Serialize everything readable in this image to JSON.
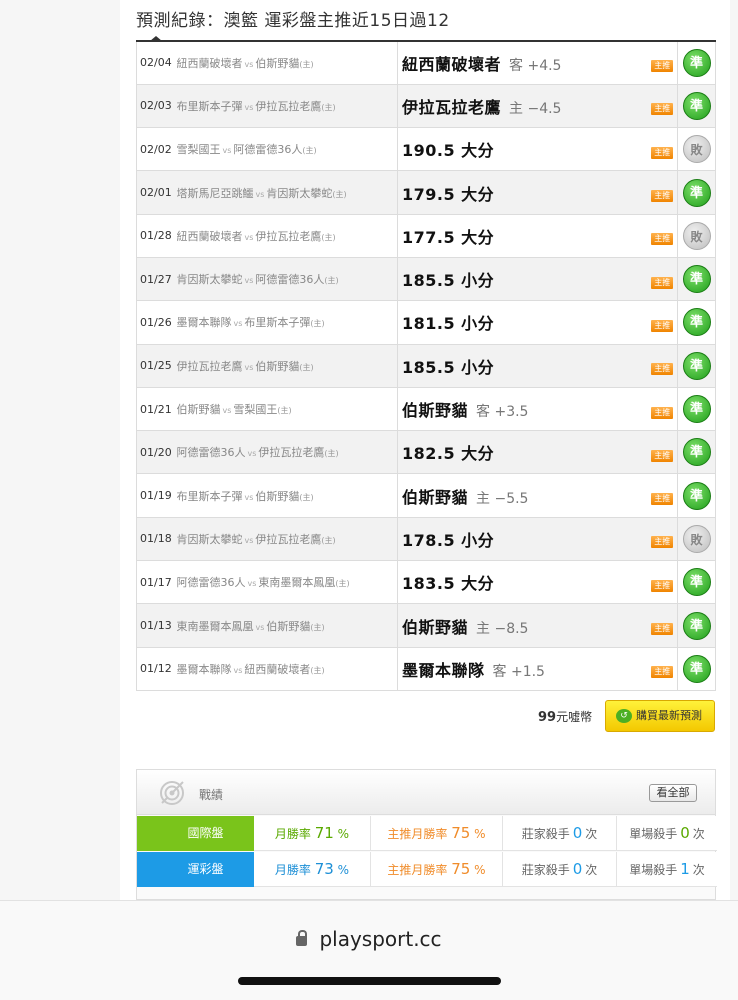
{
  "page": {
    "title": "預測紀錄：澳籃 運彩盤主推近15日過12"
  },
  "records": [
    {
      "date": "02/04",
      "away": "紐西蘭破壞者",
      "vs": "vs",
      "home": "伯斯野貓",
      "home_mark": "(主)",
      "pick": "紐西蘭破壞者",
      "line": "客 +4.5",
      "tag": "主推",
      "result": "準",
      "status": "win"
    },
    {
      "date": "02/03",
      "away": "布里斯本子彈",
      "vs": "vs",
      "home": "伊拉瓦拉老鷹",
      "home_mark": "(主)",
      "pick": "伊拉瓦拉老鷹",
      "line": "主 −4.5",
      "tag": "主推",
      "result": "準",
      "status": "win"
    },
    {
      "date": "02/02",
      "away": "雪梨國王",
      "vs": "vs",
      "home": "阿德雷德36人",
      "home_mark": "(主)",
      "pick": "190.5 大分",
      "line": "",
      "tag": "主推",
      "result": "敗",
      "status": "push"
    },
    {
      "date": "02/01",
      "away": "塔斯馬尼亞跳鱷",
      "vs": "vs",
      "home": "肯因斯太攀蛇",
      "home_mark": "(主)",
      "pick": "179.5 大分",
      "line": "",
      "tag": "主推",
      "result": "準",
      "status": "win"
    },
    {
      "date": "01/28",
      "away": "紐西蘭破壞者",
      "vs": "vs",
      "home": "伊拉瓦拉老鷹",
      "home_mark": "(主)",
      "pick": "177.5 大分",
      "line": "",
      "tag": "主推",
      "result": "敗",
      "status": "push"
    },
    {
      "date": "01/27",
      "away": "肯因斯太攀蛇",
      "vs": "vs",
      "home": "阿德雷德36人",
      "home_mark": "(主)",
      "pick": "185.5 小分",
      "line": "",
      "tag": "主推",
      "result": "準",
      "status": "win"
    },
    {
      "date": "01/26",
      "away": "墨爾本聯隊",
      "vs": "vs",
      "home": "布里斯本子彈",
      "home_mark": "(主)",
      "pick": "181.5 小分",
      "line": "",
      "tag": "主推",
      "result": "準",
      "status": "win"
    },
    {
      "date": "01/25",
      "away": "伊拉瓦拉老鷹",
      "vs": "vs",
      "home": "伯斯野貓",
      "home_mark": "(主)",
      "pick": "185.5 小分",
      "line": "",
      "tag": "主推",
      "result": "準",
      "status": "win"
    },
    {
      "date": "01/21",
      "away": "伯斯野貓",
      "vs": "vs",
      "home": "雪梨國王",
      "home_mark": "(主)",
      "pick": "伯斯野貓",
      "line": "客 +3.5",
      "tag": "主推",
      "result": "準",
      "status": "win"
    },
    {
      "date": "01/20",
      "away": "阿德雷德36人",
      "vs": "vs",
      "home": "伊拉瓦拉老鷹",
      "home_mark": "(主)",
      "pick": "182.5 大分",
      "line": "",
      "tag": "主推",
      "result": "準",
      "status": "win"
    },
    {
      "date": "01/19",
      "away": "布里斯本子彈",
      "vs": "vs",
      "home": "伯斯野貓",
      "home_mark": "(主)",
      "pick": "伯斯野貓",
      "line": "主 −5.5",
      "tag": "主推",
      "result": "準",
      "status": "win"
    },
    {
      "date": "01/18",
      "away": "肯因斯太攀蛇",
      "vs": "vs",
      "home": "伊拉瓦拉老鷹",
      "home_mark": "(主)",
      "pick": "178.5 小分",
      "line": "",
      "tag": "主推",
      "result": "敗",
      "status": "push"
    },
    {
      "date": "01/17",
      "away": "阿德雷德36人",
      "vs": "vs",
      "home": "東南墨爾本鳳凰",
      "home_mark": "(主)",
      "pick": "183.5 大分",
      "line": "",
      "tag": "主推",
      "result": "準",
      "status": "win"
    },
    {
      "date": "01/13",
      "away": "東南墨爾本鳳凰",
      "vs": "vs",
      "home": "伯斯野貓",
      "home_mark": "(主)",
      "pick": "伯斯野貓",
      "line": "主 −8.5",
      "tag": "主推",
      "result": "準",
      "status": "win"
    },
    {
      "date": "01/12",
      "away": "墨爾本聯隊",
      "vs": "vs",
      "home": "紐西蘭破壞者",
      "home_mark": "(主)",
      "pick": "墨爾本聯隊",
      "line": "客 +1.5",
      "tag": "主推",
      "result": "準",
      "status": "win"
    }
  ],
  "purchase": {
    "price": "99",
    "unit": "元噓幣",
    "button_label": "購買最新預測",
    "cart_glyph": "↺"
  },
  "stats": {
    "title": "戰績",
    "see_all": "看全部",
    "rows": [
      {
        "label": "國際盤",
        "monthly_label": "月勝率",
        "monthly": "71",
        "main_label": "主推月勝率",
        "main": "75",
        "pct": "%",
        "banker_label": "莊家殺手",
        "banker": "0",
        "single_label": "單場殺手",
        "single": "0",
        "times": "次",
        "color": "#7ac41b"
      },
      {
        "label": "運彩盤",
        "monthly_label": "月勝率",
        "monthly": "73",
        "main_label": "主推月勝率",
        "main": "75",
        "pct": "%",
        "banker_label": "莊家殺手",
        "banker": "0",
        "single_label": "單場殺手",
        "single": "1",
        "times": "次",
        "color": "#1d9be6"
      }
    ]
  },
  "browser": {
    "url": "playsport.cc"
  }
}
